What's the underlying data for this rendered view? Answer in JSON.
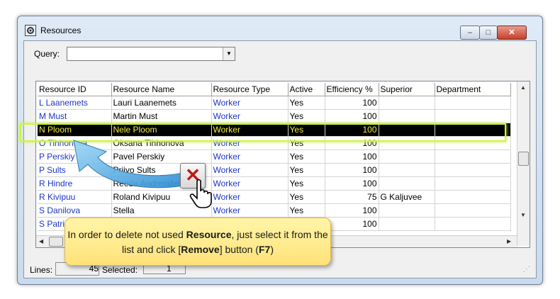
{
  "window": {
    "title": "Resources",
    "buttons": {
      "minimize": "–",
      "maximize": "□",
      "close": "✕"
    }
  },
  "query": {
    "label": "Query:",
    "value": ""
  },
  "grid": {
    "columns": [
      "Resource ID",
      "Resource Name",
      "Resource Type",
      "Active",
      "Efficiency %",
      "Superior",
      "Department"
    ],
    "rows": [
      [
        "L Laanemets",
        "Lauri Laanemets",
        "Worker",
        "Yes",
        "100",
        "",
        ""
      ],
      [
        "M Must",
        "Martin Must",
        "Worker",
        "Yes",
        "100",
        "",
        ""
      ],
      [
        "N Ploom",
        "Nele Ploom",
        "Worker",
        "Yes",
        "100",
        "",
        ""
      ],
      [
        "O Tihhonova",
        "Oksana Tihhonova",
        "Worker",
        "Yes",
        "100",
        "",
        ""
      ],
      [
        "P Perskiy",
        "Pavel Perskiy",
        "Worker",
        "Yes",
        "100",
        "",
        ""
      ],
      [
        "P Sults",
        "Priivo Sults",
        "Worker",
        "Yes",
        "100",
        "",
        ""
      ],
      [
        "R Hindre",
        "Reeda Andremäe",
        "Worker",
        "Yes",
        "100",
        "",
        ""
      ],
      [
        "R Kivipuu",
        "Roland Kivipuu",
        "Worker",
        "Yes",
        "75",
        "G Kaljuvee",
        ""
      ],
      [
        "S Danilova",
        "Stella",
        "Worker",
        "Yes",
        "100",
        "",
        ""
      ],
      [
        "S Patric",
        "",
        "",
        "",
        "100",
        "",
        ""
      ]
    ],
    "selected_index": 2
  },
  "status": {
    "lines_label": "Lines:",
    "lines_value": "45",
    "selected_label": "Selected:",
    "selected_value": "1"
  },
  "callout": {
    "pre": "In order to delete not used ",
    "b1": "Resource",
    "mid": ", just select it from the list and click [",
    "b2": "Remove",
    "mid2": "] button (",
    "b3": "F7",
    "end": ")"
  },
  "colors": {
    "link": "#1c35c6",
    "selection_bg": "#000000",
    "selection_text": "#f3ef3b",
    "highlight": "#cdf542",
    "callout_bg": "#fff0a0"
  },
  "icons": {
    "remove": "remove-x-icon",
    "hand": "hand-cursor-icon",
    "arrow": "curved-arrow-icon"
  }
}
